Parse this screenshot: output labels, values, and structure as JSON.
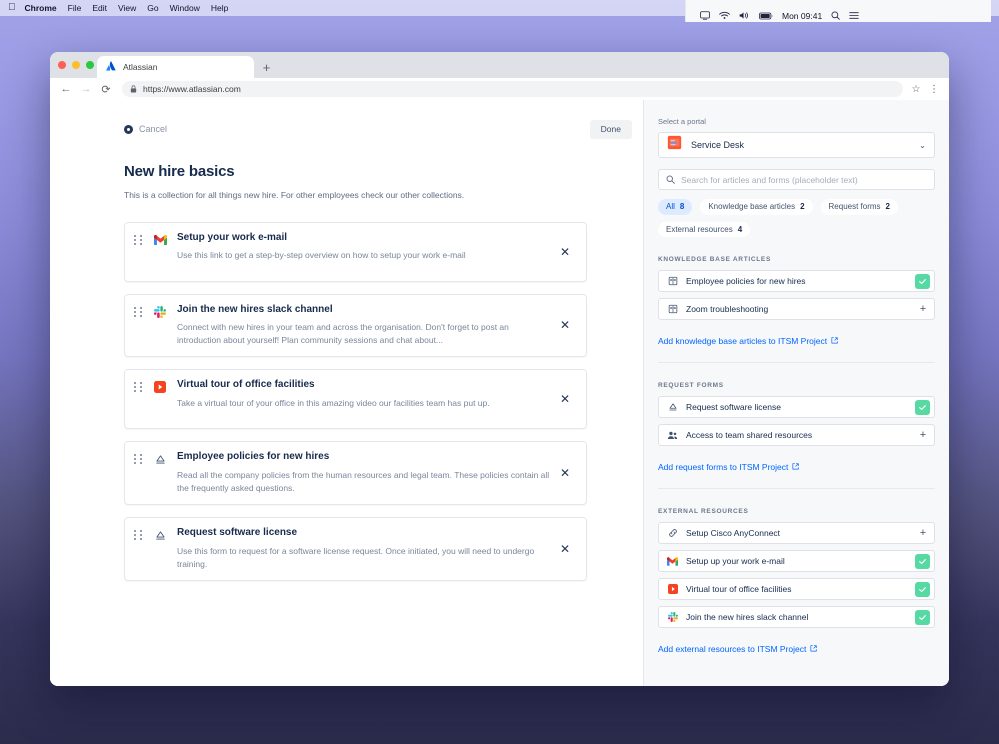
{
  "menubar": {
    "apple_glyph": "",
    "items": [
      "Chrome",
      "File",
      "Edit",
      "View",
      "Go",
      "Window",
      "Help"
    ],
    "clock": "Mon 09:41"
  },
  "browser": {
    "tab_title": "Atlassian",
    "new_tab_label": "+",
    "url": "https://www.atlassian.com",
    "back_glyph": "←",
    "forward_glyph": "→",
    "reload_glyph": "⟳",
    "star_glyph": "☆",
    "menu_glyph": "⋮"
  },
  "main": {
    "cancel_label": "Cancel",
    "done_label": "Done",
    "title": "New hire basics",
    "subtitle": "This is a collection for all things new hire. For other employees check our other collections.",
    "close_glyph": "✕",
    "items": [
      {
        "icon": "gmail-icon",
        "title": "Setup your work e-mail",
        "description": "Use this link to get a step-by-step overview on how to setup your work e-mail"
      },
      {
        "icon": "slack-icon",
        "title": "Join the new hires slack channel",
        "description": "Connect with new hires in your team and across the organisation. Don't forget to post an introduction about yourself! Plan community sessions and chat about..."
      },
      {
        "icon": "youtube-icon",
        "title": "Virtual tour of office facilities",
        "description": "Take a virtual tour of your office in this amazing video our facilities team has put up."
      },
      {
        "icon": "request-type-icon",
        "title": "Employee policies for new hires",
        "description": "Read all the company policies from the human resources and legal team. These policies contain all the frequently asked questions."
      },
      {
        "icon": "request-type-icon",
        "title": "Request software license",
        "description": "Use this form to request for a software license request. Once initiated, you will need to undergo training."
      }
    ]
  },
  "sidebar": {
    "portal_label": "Select a portal",
    "portal_value": "Service Desk",
    "portal_icon": "service-desk-icon",
    "chevron_glyph": "⌄",
    "search_placeholder": "Search for articles and forms (placeholder text)",
    "filters": [
      {
        "label": "All",
        "count": "8"
      },
      {
        "label": "Knowledge base articles",
        "count": "2"
      },
      {
        "label": "Request forms",
        "count": "2"
      },
      {
        "label": "External resources",
        "count": "4"
      }
    ],
    "add_glyph": "+",
    "check_glyph": "✓",
    "external_link_glyph": "↗",
    "sections": [
      {
        "title": "KNOWLEDGE BASE ARTICLES",
        "link": "Add knowledge base articles to ITSM Project",
        "items": [
          {
            "icon": "article-icon",
            "label": "Employee policies for new hires",
            "state": "added"
          },
          {
            "icon": "article-icon",
            "label": "Zoom troubleshooting",
            "state": "add"
          }
        ]
      },
      {
        "title": "REQUEST FORMS",
        "link": "Add request forms to ITSM Project",
        "items": [
          {
            "icon": "request-type-icon",
            "label": "Request software license",
            "state": "added"
          },
          {
            "icon": "people-icon",
            "label": "Access to team shared resources",
            "state": "add"
          }
        ]
      },
      {
        "title": "EXTERNAL RESOURCES",
        "link": "Add external resources to ITSM Project",
        "items": [
          {
            "icon": "link-icon",
            "label": "Setup Cisco AnyConnect",
            "state": "add"
          },
          {
            "icon": "gmail-icon",
            "label": "Setup up your work e-mail",
            "state": "added"
          },
          {
            "icon": "youtube-icon",
            "label": "Virtual tour of office facilities",
            "state": "added"
          },
          {
            "icon": "slack-icon",
            "label": "Join the new hires slack channel",
            "state": "added"
          }
        ]
      }
    ]
  },
  "colors": {
    "accent_blue": "#0065FF",
    "chip_selected_bg": "#DEEBFF",
    "success_green": "#57D9A3",
    "text_primary": "#172B4D",
    "text_subtle": "#7A869A"
  }
}
